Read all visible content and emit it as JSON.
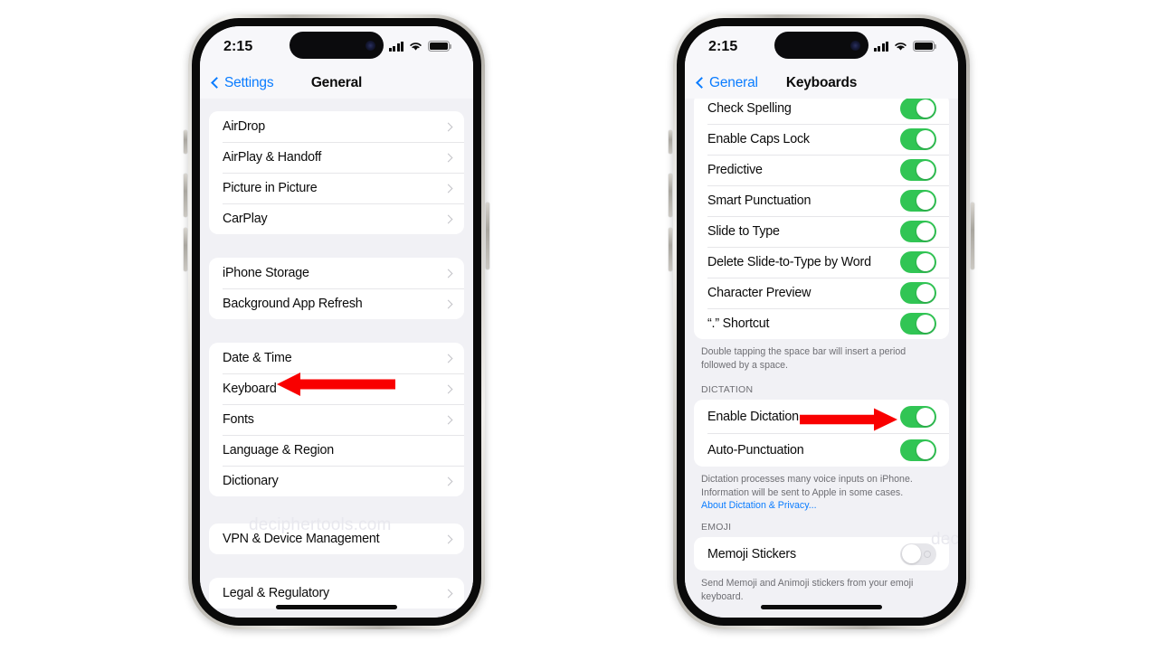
{
  "watermark": "deciphertools.com",
  "accent_colors": {
    "link_blue": "#0a7cff",
    "toggle_on_green": "#31c554",
    "toggle_off_gray": "#e6e6ea",
    "arrow_red": "#f90000"
  },
  "left_phone": {
    "status_bar": {
      "time": "2:15",
      "cellular": "signal-bars",
      "wifi": "wifi-icon",
      "battery": "battery-full-icon"
    },
    "nav": {
      "back_label": "Settings",
      "title": "General"
    },
    "groups": [
      {
        "rows": [
          {
            "label": "AirDrop",
            "accessory": "chevron"
          },
          {
            "label": "AirPlay & Handoff",
            "accessory": "chevron"
          },
          {
            "label": "Picture in Picture",
            "accessory": "chevron"
          },
          {
            "label": "CarPlay",
            "accessory": "chevron"
          }
        ]
      },
      {
        "rows": [
          {
            "label": "iPhone Storage",
            "accessory": "chevron"
          },
          {
            "label": "Background App Refresh",
            "accessory": "chevron"
          }
        ]
      },
      {
        "rows": [
          {
            "label": "Date & Time",
            "accessory": "chevron"
          },
          {
            "label": "Keyboard",
            "accessory": "chevron"
          },
          {
            "label": "Fonts",
            "accessory": "chevron"
          },
          {
            "label": "Language & Region",
            "accessory": "none"
          },
          {
            "label": "Dictionary",
            "accessory": "chevron"
          }
        ]
      },
      {
        "rows": [
          {
            "label": "VPN & Device Management",
            "accessory": "chevron"
          }
        ]
      },
      {
        "rows": [
          {
            "label": "Legal & Regulatory",
            "accessory": "chevron"
          }
        ]
      }
    ],
    "annotation": {
      "type": "arrow-left",
      "points_at": "Keyboard"
    }
  },
  "right_phone": {
    "status_bar": {
      "time": "2:15",
      "cellular": "signal-bars",
      "wifi": "wifi-icon",
      "battery": "battery-full-icon"
    },
    "nav": {
      "back_label": "General",
      "title": "Keyboards"
    },
    "keyboard_group": {
      "rows": [
        {
          "label": "Check Spelling",
          "toggle": "on"
        },
        {
          "label": "Enable Caps Lock",
          "toggle": "on"
        },
        {
          "label": "Predictive",
          "toggle": "on"
        },
        {
          "label": "Smart Punctuation",
          "toggle": "on"
        },
        {
          "label": "Slide to Type",
          "toggle": "on"
        },
        {
          "label": "Delete Slide-to-Type by Word",
          "toggle": "on"
        },
        {
          "label": "Character Preview",
          "toggle": "on"
        },
        {
          "label": "“.” Shortcut",
          "toggle": "on"
        }
      ],
      "footer": "Double tapping the space bar will insert a period followed by a space."
    },
    "dictation_section": {
      "header": "DICTATION",
      "rows": [
        {
          "label": "Enable Dictation",
          "toggle": "on"
        },
        {
          "label": "Auto-Punctuation",
          "toggle": "on"
        }
      ],
      "footer": "Dictation processes many voice inputs on iPhone. Information will be sent to Apple in some cases.",
      "footer_link": "About Dictation & Privacy..."
    },
    "emoji_section": {
      "header": "EMOJI",
      "rows": [
        {
          "label": "Memoji Stickers",
          "toggle": "off"
        }
      ],
      "footer": "Send Memoji and Animoji stickers from your emoji keyboard."
    },
    "annotation": {
      "type": "arrow-right",
      "points_at": "Enable Dictation"
    }
  }
}
